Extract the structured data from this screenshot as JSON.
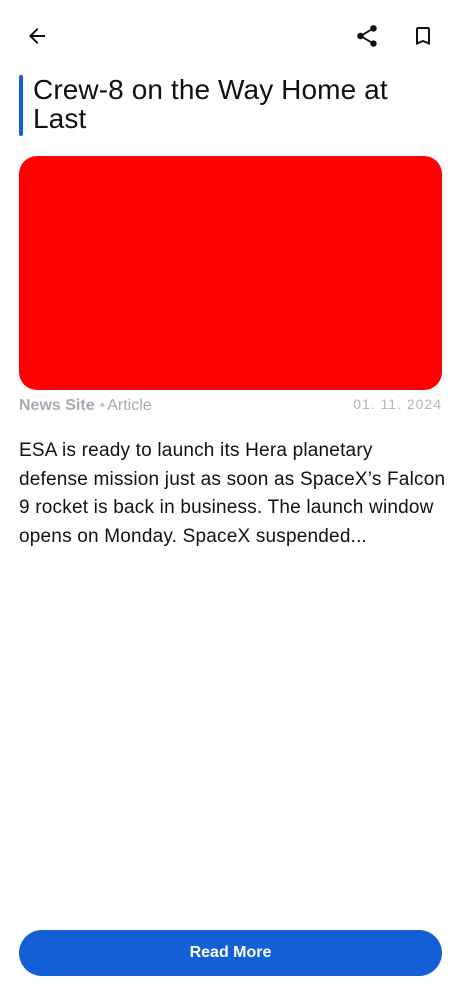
{
  "toolbar": {
    "back_icon": "arrow-left-icon",
    "share_icon": "share-icon",
    "bookmark_icon": "bookmark-icon"
  },
  "article": {
    "title": "Crew-8 on the Way Home at Last",
    "image_color": "#ff0000",
    "source": "News Site",
    "separator": "•",
    "type": "Article",
    "date": "01. 11. 2024",
    "summary": "ESA is ready to launch its Hera planetary defense mission just as soon as SpaceX’s Falcon 9 rocket is back in business. The launch window opens on Monday. SpaceX suspended..."
  },
  "actions": {
    "read_more_label": "Read More"
  },
  "colors": {
    "accent": "#135fd6",
    "meta_text": "#a7abb3",
    "body_text": "#111111"
  }
}
